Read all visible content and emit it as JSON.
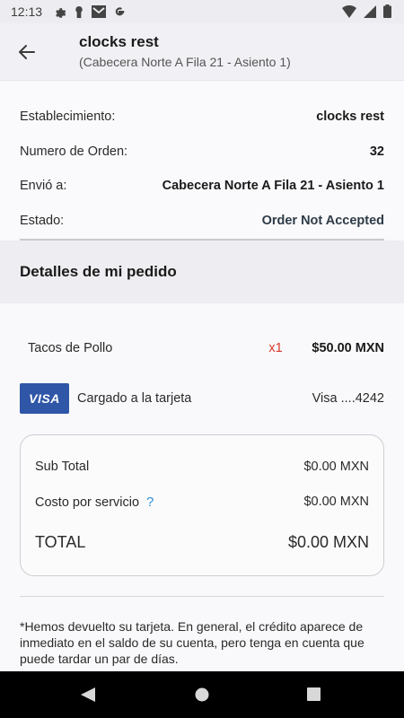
{
  "status_bar": {
    "time": "12:13",
    "left_icons": [
      "gear-icon",
      "keyhole-icon",
      "mail-icon",
      "google-icon"
    ],
    "right_icons": [
      "wifi-icon",
      "signal-icon",
      "battery-icon"
    ]
  },
  "header": {
    "title": "clocks rest",
    "subtitle": "(Cabecera Norte A Fila 21 - Asiento 1)"
  },
  "info": {
    "establishment_label": "Establecimiento:",
    "establishment_value": "clocks rest",
    "order_label": "Numero de Orden:",
    "order_value": "32",
    "sent_label": "Envió a:",
    "sent_value": "Cabecera Norte A Fila 21 - Asiento 1",
    "status_label": "Estado:",
    "status_value": "Order Not Accepted"
  },
  "details_header": "Detalles de mi pedido",
  "items": [
    {
      "name": "Tacos de Pollo",
      "qty": "x1",
      "price": "$50.00 MXN"
    }
  ],
  "payment": {
    "brand": "VISA",
    "label": "Cargado a la tarjeta",
    "card": "Visa ....4242"
  },
  "totals": {
    "subtotal_label": "Sub Total",
    "subtotal_value": "$0.00 MXN",
    "service_label": "Costo por servicio",
    "service_help": "?",
    "service_value": "$0.00 MXN",
    "total_label": "TOTAL",
    "total_value": "$0.00 MXN"
  },
  "notice": "*Hemos devuelto su tarjeta. En general, el crédito aparece de inmediato en el saldo de su cuenta, pero tenga en cuenta que puede tardar un par de días.",
  "colors": {
    "accent_red": "#d9382b",
    "help_blue": "#2e8fd6",
    "visa_blue": "#2f56a7"
  }
}
